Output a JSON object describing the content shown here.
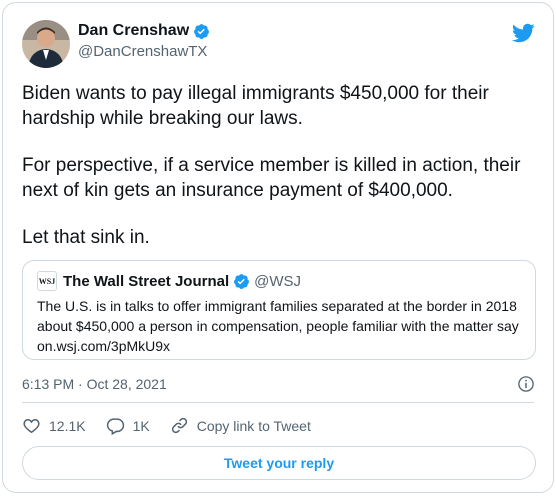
{
  "author": {
    "name": "Dan Crenshaw",
    "handle": "@DanCrenshawTX"
  },
  "tweet": {
    "paragraphs": [
      "Biden wants to pay illegal immigrants $450,000 for their hardship while breaking our laws.",
      "For perspective, if a service member is killed in action, their next of kin gets an insurance payment of $400,000.",
      "Let that sink in."
    ],
    "timestamp": "6:13 PM · Oct 28, 2021"
  },
  "quote": {
    "logo_text": "WSJ",
    "name": "The Wall Street Journal",
    "handle": "@WSJ",
    "text": "The U.S. is in talks to offer immigrant families separated at the border in 2018 about $450,000 a person in compensation, people familiar with the matter say on.wsj.com/3pMkU9x"
  },
  "actions": {
    "likes": "12.1K",
    "replies": "1K",
    "copy_link": "Copy link to Tweet"
  },
  "reply_button": "Tweet your reply",
  "colors": {
    "accent": "#1d9bf0",
    "text": "#0f1419",
    "muted": "#536471",
    "border": "#cfd9de"
  }
}
